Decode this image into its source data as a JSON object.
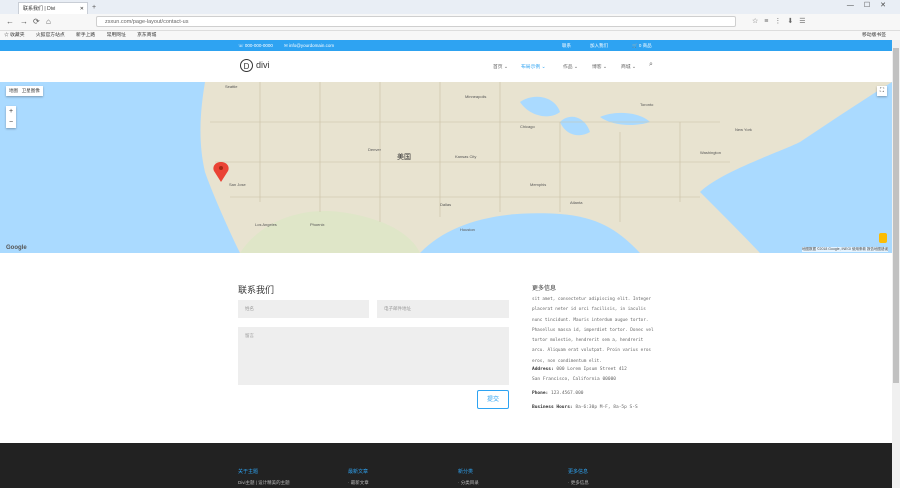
{
  "browser": {
    "tab_title": "联系我们 | Divi",
    "new_tab": "+",
    "window_controls": [
      "—",
      "☐",
      "✕"
    ],
    "nav": {
      "back": "←",
      "forward": "→",
      "reload": "⟳",
      "home": "⌂"
    },
    "url": "zsxun.com/page-layout/contact-us",
    "bookmarks": [
      "☆ 收藏夹",
      "火狐官方站点",
      "新手上路",
      "常用网址",
      "京东商城"
    ],
    "bookmarks_other": "移动版书签",
    "toolbar_icons": [
      "☆",
      "≡",
      "⋮",
      "⬇",
      "☰"
    ]
  },
  "topbar": {
    "phone": "☏ 000-000-0000",
    "email": "✉ info@yourdomain.com",
    "links": [
      "联系",
      "加入我们",
      "🛒 0 商品"
    ]
  },
  "header": {
    "logo_letter": "D",
    "logo_text": "divi",
    "menu": [
      {
        "label": "首页 ⌄",
        "active": false
      },
      {
        "label": "布局示例 ⌄",
        "active": true
      },
      {
        "label": "作品 ⌄",
        "active": false
      },
      {
        "label": "博客 ⌄",
        "active": false
      },
      {
        "label": "商城 ⌄",
        "active": false
      }
    ],
    "search_icon": "⌕"
  },
  "map": {
    "type_buttons": [
      "地图",
      "卫星图像"
    ],
    "zoom_in": "+",
    "zoom_out": "−",
    "fullscreen": "⛶",
    "country_label": "美国",
    "labels": [
      "Chicago",
      "Denver",
      "Dallas",
      "Houston",
      "Atlanta",
      "Toronto",
      "New York",
      "Washington",
      "Los Angeles",
      "San Jose",
      "Phoenix",
      "Minneapolis",
      "Kansas City",
      "Memphis",
      "Seattle"
    ],
    "google_logo": "Google",
    "footer_text": "地图数据 ©2018 Google, INEGI 使用条款 报告地图错误"
  },
  "contact": {
    "title": "联系我们",
    "name_placeholder": "姓名",
    "email_placeholder": "电子邮件地址",
    "message_placeholder": "留言",
    "submit_label": "提交"
  },
  "info": {
    "title": "更多信息",
    "body": "sit amet, consectetur adipiscing elit. Integer placerat neter id orci facilisis, in iaculis nunc tincidunt. Mauris interdum augue tortor. Phasellus massa id, imperdiet tortor. Donec vel tortor molestie, hendrerit sem a, hendrerit arcu. Aliquam erat volutpat. Proin varius eros eros, non condimentum elit.",
    "address_label": "Address:",
    "address_line1": "000 Lorem Ipsum Street 412",
    "address_line2": "San Francisco, California 00000",
    "phone_label": "Phone:",
    "phone_value": "123.4567.000",
    "hours_label": "Business Hours:",
    "hours_value": "8a-6:30p M-F, 8a-5p S-S"
  },
  "footer": {
    "columns": [
      {
        "title": "关于主题",
        "item": "Divi主题 | 设计精美的主题"
      },
      {
        "title": "最新文章",
        "item": "· 最新文章"
      },
      {
        "title": "新分类",
        "item": "· 分类目录"
      },
      {
        "title": "更多信息",
        "item": "· 更多信息"
      }
    ]
  },
  "colors": {
    "accent": "#2ea3f2",
    "footer_bg": "#222222",
    "field_bg": "#eeeeee",
    "map_land": "#e8e3d0",
    "map_water": "#aadaff",
    "pin": "#ea4335"
  }
}
